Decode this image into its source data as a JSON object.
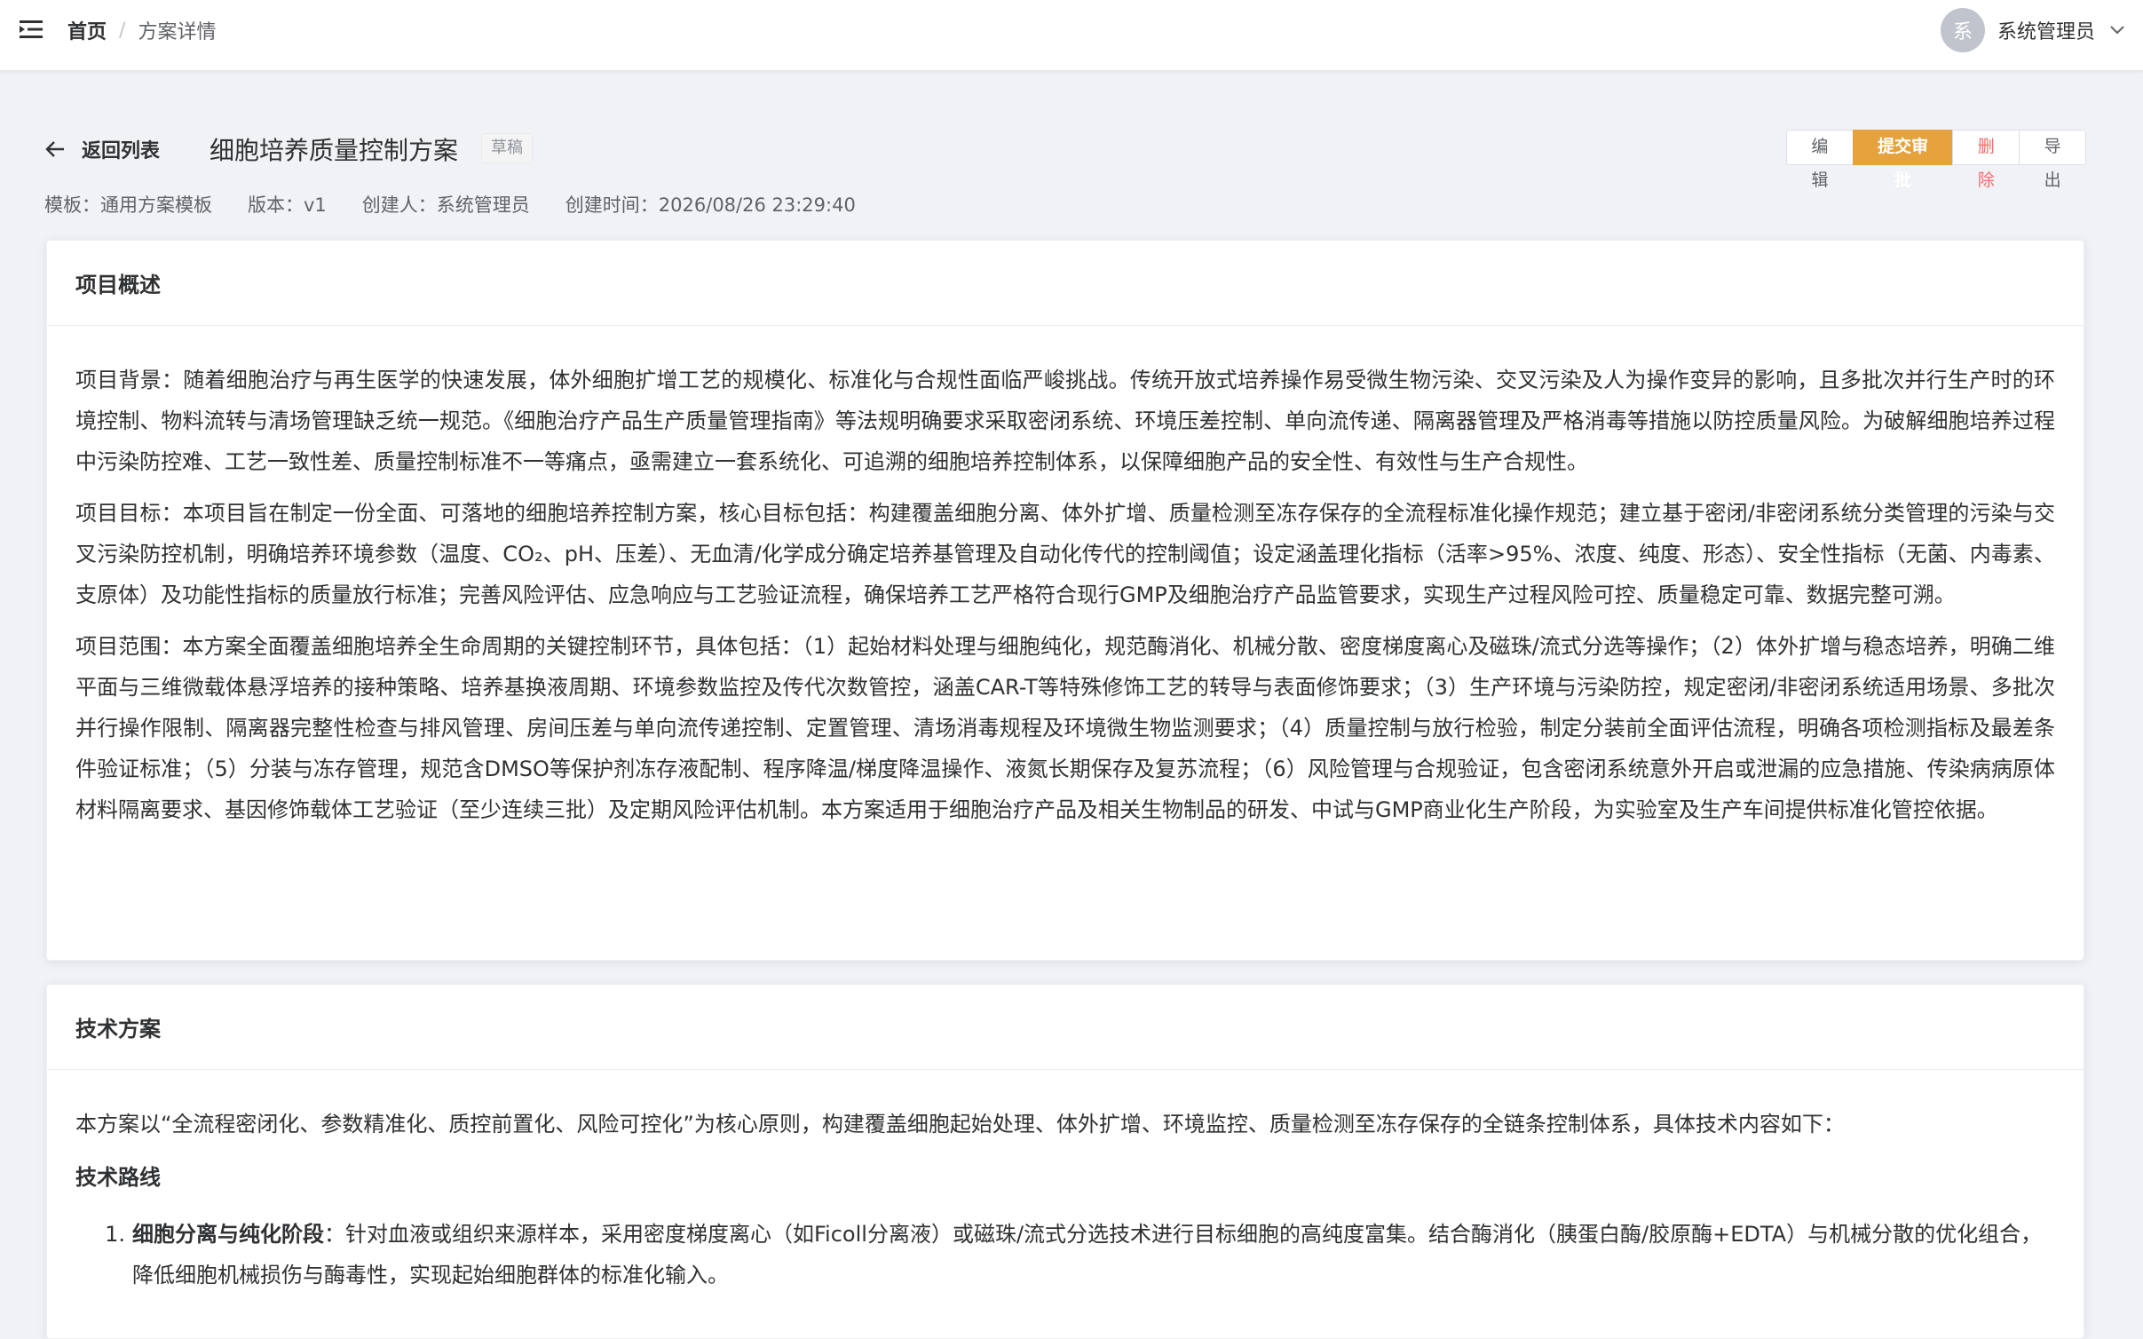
{
  "navbar": {
    "breadcrumb_home": "首页",
    "breadcrumb_sep": "/",
    "breadcrumb_current": "方案详情",
    "avatar_text": "系",
    "username": "系统管理员"
  },
  "header": {
    "back_label": "返回列表",
    "title": "细胞培养质量控制方案",
    "status_tag": "草稿",
    "buttons": {
      "edit": "编辑",
      "submit": "提交审批",
      "delete": "删除",
      "export": "导出"
    }
  },
  "meta": {
    "template": "模板：通用方案模板",
    "version": "版本：v1",
    "creator": "创建人：系统管理员",
    "created_at": "创建时间：2026/08/26 23:29:40"
  },
  "overview": {
    "title": "项目概述",
    "background": "项目背景：随着细胞治疗与再生医学的快速发展，体外细胞扩增工艺的规模化、标准化与合规性面临严峻挑战。传统开放式培养操作易受微生物污染、交叉污染及人为操作变异的影响，且多批次并行生产时的环境控制、物料流转与清场管理缺乏统一规范。《细胞治疗产品生产质量管理指南》等法规明确要求采取密闭系统、环境压差控制、单向流传递、隔离器管理及严格消毒等措施以防控质量风险。为破解细胞培养过程中污染防控难、工艺一致性差、质量控制标准不一等痛点，亟需建立一套系统化、可追溯的细胞培养控制体系，以保障细胞产品的安全性、有效性与生产合规性。",
    "goal": "项目目标：本项目旨在制定一份全面、可落地的细胞培养控制方案，核心目标包括：构建覆盖细胞分离、体外扩增、质量检测至冻存保存的全流程标准化操作规范；建立基于密闭/非密闭系统分类管理的污染与交叉污染防控机制，明确培养环境参数（温度、CO₂、pH、压差）、无血清/化学成分确定培养基管理及自动化传代的控制阈值；设定涵盖理化指标（活率>95%、浓度、纯度、形态）、安全性指标（无菌、内毒素、支原体）及功能性指标的质量放行标准；完善风险评估、应急响应与工艺验证流程，确保培养工艺严格符合现行GMP及细胞治疗产品监管要求，实现生产过程风险可控、质量稳定可靠、数据完整可溯。",
    "scope": "项目范围：本方案全面覆盖细胞培养全生命周期的关键控制环节，具体包括：（1）起始材料处理与细胞纯化，规范酶消化、机械分散、密度梯度离心及磁珠/流式分选等操作；（2）体外扩增与稳态培养，明确二维平面与三维微载体悬浮培养的接种策略、培养基换液周期、环境参数监控及传代次数管控，涵盖CAR-T等特殊修饰工艺的转导与表面修饰要求；（3）生产环境与污染防控，规定密闭/非密闭系统适用场景、多批次并行操作限制、隔离器完整性检查与排风管理、房间压差与单向流传递控制、定置管理、清场消毒规程及环境微生物监测要求；（4）质量控制与放行检验，制定分装前全面评估流程，明确各项检测指标及最差条件验证标准；（5）分装与冻存管理，规范含DMSO等保护剂冻存液配制、程序降温/梯度降温操作、液氮长期保存及复苏流程；（6）风险管理与合规验证，包含密闭系统意外开启或泄漏的应急措施、传染病病原体材料隔离要求、基因修饰载体工艺验证（至少连续三批）及定期风险评估机制。本方案适用于细胞治疗产品及相关生物制品的研发、中试与GMP商业化生产阶段，为实验室及生产车间提供标准化管控依据。"
  },
  "tech": {
    "title": "技术方案",
    "intro": "本方案以“全流程密闭化、参数精准化、质控前置化、风险可控化”为核心原则，构建覆盖细胞起始处理、体外扩增、环境监控、质量检测至冻存保存的全链条控制体系，具体技术内容如下：",
    "route_heading": "技术路线",
    "items": [
      {
        "num": "1.",
        "label": "细胞分离与纯化阶段",
        "text": "：针对血液或组织来源样本，采用密度梯度离心（如Ficoll分离液）或磁珠/流式分选技术进行目标细胞的高纯度富集。结合酶消化（胰蛋白酶/胶原酶+EDTA）与机械分散的优化组合，降低细胞机械损伤与酶毒性，实现起始细胞群体的标准化输入。"
      }
    ]
  },
  "icons": {
    "hamburger": "menu-fold-icon",
    "back": "arrow-left-icon",
    "dropdown": "chevron-down-icon"
  },
  "colors": {
    "warning": "#e6a23c",
    "danger": "#f56c6c",
    "text": "#303133",
    "secondary_text": "#606266",
    "page_bg": "#f0f2f5"
  }
}
